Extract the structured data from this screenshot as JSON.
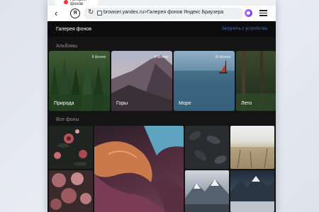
{
  "browser": {
    "tab_title": "Галерея фонов",
    "url": "browser.yandex.ru>Галерея фонов Яндекс Браузера",
    "home_label": "Я"
  },
  "page": {
    "title": "Галерея фонов",
    "upload_link": "Загрузить с устройства"
  },
  "albums_section": {
    "label": "Альбомы",
    "items": [
      {
        "label": "Природа",
        "count": "8 фонов"
      },
      {
        "label": "Горы",
        "count": "8 фонов"
      },
      {
        "label": "Море",
        "count": "16 фонов"
      },
      {
        "label": "Лето",
        "count": ""
      }
    ]
  },
  "all_section": {
    "label": "Все фоны"
  },
  "colors": {
    "page_bg": "#141414",
    "link": "#4a6ed8",
    "alice": "#9b5cff"
  }
}
